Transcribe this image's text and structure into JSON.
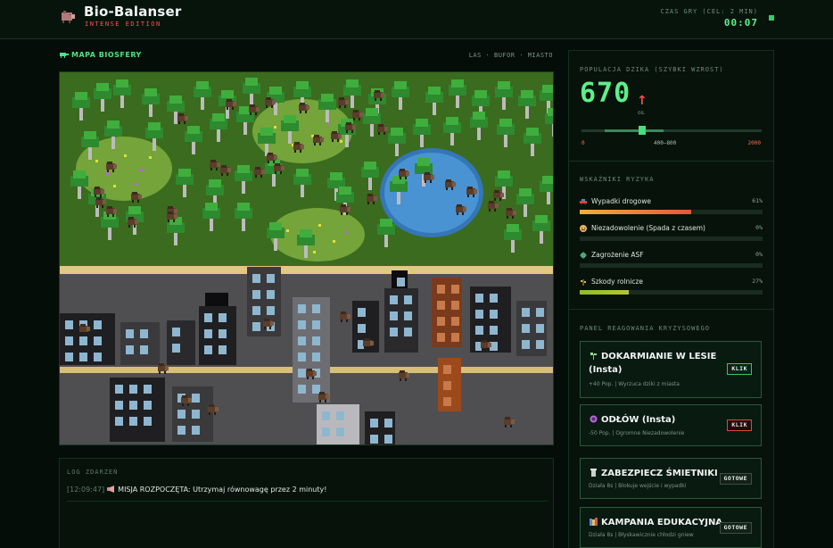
{
  "header": {
    "title": "Bio-Balanser",
    "subtitle": "INTENSE EDITION",
    "timer_label": "CZAS GRY (CEL: 2 MIN)",
    "timer_value": "00:07"
  },
  "map": {
    "title": "MAPA BIOSFERY",
    "legend": "LAS · BUFOR · MIASTO"
  },
  "event_log": {
    "title": "LOG ZDARZEŃ",
    "entries": [
      {
        "timestamp": "[12:09:47]",
        "text": "MISJA ROZPOCZĘTA: Utrzymaj równowagę przez 2 minuty!"
      }
    ]
  },
  "population": {
    "title": "POPULACJA DZIKA (SZYBKI WZROST)",
    "value": "670",
    "trend": "↑",
    "unit": "os.",
    "scale_min": "0",
    "scale_target": "400—800",
    "scale_max": "2000",
    "min": 0,
    "max": 2000,
    "target_low": 400,
    "target_high": 800,
    "current": 670
  },
  "risk": {
    "title": "WSKAŹNIKI RYZYKA",
    "items": [
      {
        "label": "Wypadki drogowe",
        "value": "61%",
        "level": 61,
        "color": "#e8553a",
        "icon": "car-icon"
      },
      {
        "label": "Niezadowolenie (Spada z czasem)",
        "value": "0%",
        "level": 0,
        "color": "#e0c25a",
        "icon": "angry-face-icon"
      },
      {
        "label": "Zagrożenie ASF",
        "value": "0%",
        "level": 0,
        "color": "#59c07a",
        "icon": "virus-icon"
      },
      {
        "label": "Szkody rolnicze",
        "value": "27%",
        "level": 27,
        "color": "#b4c23c",
        "icon": "crop-icon"
      }
    ]
  },
  "crisis": {
    "title": "PANEL REAGOWANIA KRYZYSOWEGO",
    "actions": [
      {
        "name": "DOKARMIANIE W LESIE (Insta)",
        "name_line1": "DOKARMIANIE W LESIE",
        "name_line2": "(Insta)",
        "desc": "+40 Pop. | Wyrzuca dziki z miasta",
        "button": "KLIK",
        "button_style": "green",
        "icon": "sprout-icon"
      },
      {
        "name": "ODŁÓW (Insta)",
        "desc": "-50 Pop. | Ogromne Niezadowolenie",
        "button": "KLIK",
        "button_style": "red",
        "icon": "trap-icon"
      },
      {
        "name": "ZABEZPIECZ ŚMIETNIKI",
        "desc": "Działa 8s | Blokuje wejście i wypadki",
        "button": "GOTOWE",
        "button_style": "ready",
        "icon": "trash-bin-icon"
      },
      {
        "name": "KAMPANIA EDUKACYJNA",
        "desc": "Działa 8s | Błyskawicznie chłodzi gniew",
        "button": "GOTOWE",
        "button_style": "ready",
        "icon": "books-icon"
      }
    ]
  },
  "colors": {
    "accent": "#5cf08a",
    "alert": "#ff4d4d",
    "forest": "#3b6b1e",
    "city": "#4f4f52",
    "water": "#3d87c4"
  }
}
